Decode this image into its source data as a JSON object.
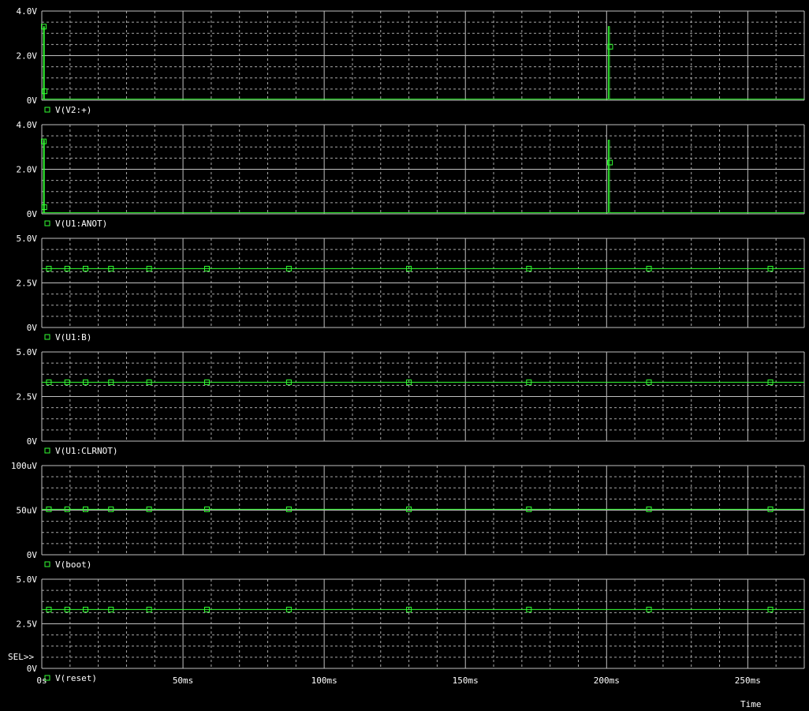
{
  "colors": {
    "background": "#000000",
    "trace": "#33ff33",
    "grid_major": "#c0c0c0",
    "grid_minor": "#a8a8a8",
    "text": "#ffffff"
  },
  "sel_marker": "SEL>>",
  "chart_data": {
    "type": "line",
    "x_axis": {
      "label": "Time",
      "range_ms": [
        0,
        270
      ],
      "ticks_ms": [
        0,
        50,
        100,
        150,
        200,
        250
      ],
      "tick_labels": [
        "0s",
        "50ms",
        "100ms",
        "150ms",
        "200ms",
        "250ms"
      ]
    },
    "grid": true,
    "plots": [
      {
        "trace_label": "V(V2:+)",
        "ylim": [
          0,
          4.0
        ],
        "y_ticks": [
          0,
          2.0,
          4.0
        ],
        "y_tick_labels": [
          "0V",
          "2.0V",
          "4.0V"
        ],
        "points": [
          [
            0,
            0.05
          ],
          [
            0.6,
            0.05
          ],
          [
            0.6,
            3.3
          ],
          [
            0.9,
            3.3
          ],
          [
            0.9,
            0.05
          ],
          [
            200.6,
            0.05
          ],
          [
            200.6,
            3.3
          ],
          [
            201.0,
            3.3
          ],
          [
            201.0,
            0.05
          ],
          [
            270,
            0.05
          ]
        ],
        "markers": [
          [
            0.7,
            3.3
          ],
          [
            1.0,
            0.4
          ],
          [
            201.3,
            2.4
          ]
        ]
      },
      {
        "trace_label": "V(U1:ANOT)",
        "ylim": [
          0,
          4.0
        ],
        "y_ticks": [
          0,
          2.0,
          4.0
        ],
        "y_tick_labels": [
          "0V",
          "2.0V",
          "4.0V"
        ],
        "points": [
          [
            0,
            0.05
          ],
          [
            0.6,
            0.05
          ],
          [
            0.6,
            3.3
          ],
          [
            0.9,
            3.3
          ],
          [
            0.9,
            0.05
          ],
          [
            200.6,
            0.05
          ],
          [
            200.6,
            3.3
          ],
          [
            201.0,
            3.3
          ],
          [
            201.0,
            0.05
          ],
          [
            270,
            0.05
          ]
        ],
        "markers": [
          [
            0.7,
            3.25
          ],
          [
            0.9,
            0.3
          ],
          [
            201.2,
            2.3
          ]
        ]
      },
      {
        "trace_label": "V(U1:B)",
        "ylim": [
          0,
          5.0
        ],
        "y_ticks": [
          0,
          2.5,
          5.0
        ],
        "y_tick_labels": [
          "0V",
          "2.5V",
          "5.0V"
        ],
        "points": [
          [
            0,
            3.3
          ],
          [
            270,
            3.3
          ]
        ],
        "markers": [
          [
            2.5,
            3.3
          ],
          [
            9,
            3.3
          ],
          [
            15.5,
            3.3
          ],
          [
            24.5,
            3.3
          ],
          [
            38,
            3.3
          ],
          [
            58.5,
            3.3
          ],
          [
            87.5,
            3.3
          ],
          [
            130,
            3.3
          ],
          [
            172.5,
            3.3
          ],
          [
            215,
            3.3
          ],
          [
            258,
            3.3
          ]
        ]
      },
      {
        "trace_label": "V(U1:CLRNOT)",
        "ylim": [
          0,
          5.0
        ],
        "y_ticks": [
          0,
          2.5,
          5.0
        ],
        "y_tick_labels": [
          "0V",
          "2.5V",
          "5.0V"
        ],
        "points": [
          [
            0,
            3.3
          ],
          [
            270,
            3.3
          ]
        ],
        "markers": [
          [
            2.5,
            3.3
          ],
          [
            9,
            3.3
          ],
          [
            15.5,
            3.3
          ],
          [
            24.5,
            3.3
          ],
          [
            38,
            3.3
          ],
          [
            58.5,
            3.3
          ],
          [
            87.5,
            3.3
          ],
          [
            130,
            3.3
          ],
          [
            172.5,
            3.3
          ],
          [
            215,
            3.3
          ],
          [
            258,
            3.3
          ]
        ]
      },
      {
        "trace_label": "V(boot)",
        "ylim": [
          0,
          100
        ],
        "y_ticks": [
          0,
          50,
          100
        ],
        "y_tick_labels": [
          "0V",
          "50uV",
          "100uV"
        ],
        "points": [
          [
            0,
            51
          ],
          [
            270,
            51
          ]
        ],
        "markers": [
          [
            2.5,
            51
          ],
          [
            9,
            51
          ],
          [
            15.5,
            51
          ],
          [
            24.5,
            51
          ],
          [
            38,
            51
          ],
          [
            58.5,
            51
          ],
          [
            87.5,
            51
          ],
          [
            130,
            51
          ],
          [
            172.5,
            51
          ],
          [
            215,
            51
          ],
          [
            258,
            51
          ]
        ]
      },
      {
        "trace_label": "V(reset)",
        "ylim": [
          0,
          5.0
        ],
        "y_ticks": [
          0,
          2.5,
          5.0
        ],
        "y_tick_labels": [
          "0V",
          "2.5V",
          "5.0V"
        ],
        "points": [
          [
            0,
            3.3
          ],
          [
            270,
            3.3
          ]
        ],
        "markers": [
          [
            2.5,
            3.3
          ],
          [
            9,
            3.3
          ],
          [
            15.5,
            3.3
          ],
          [
            24.5,
            3.3
          ],
          [
            38,
            3.3
          ],
          [
            58.5,
            3.3
          ],
          [
            87.5,
            3.3
          ],
          [
            130,
            3.3
          ],
          [
            172.5,
            3.3
          ],
          [
            215,
            3.3
          ],
          [
            258,
            3.3
          ]
        ]
      }
    ]
  }
}
